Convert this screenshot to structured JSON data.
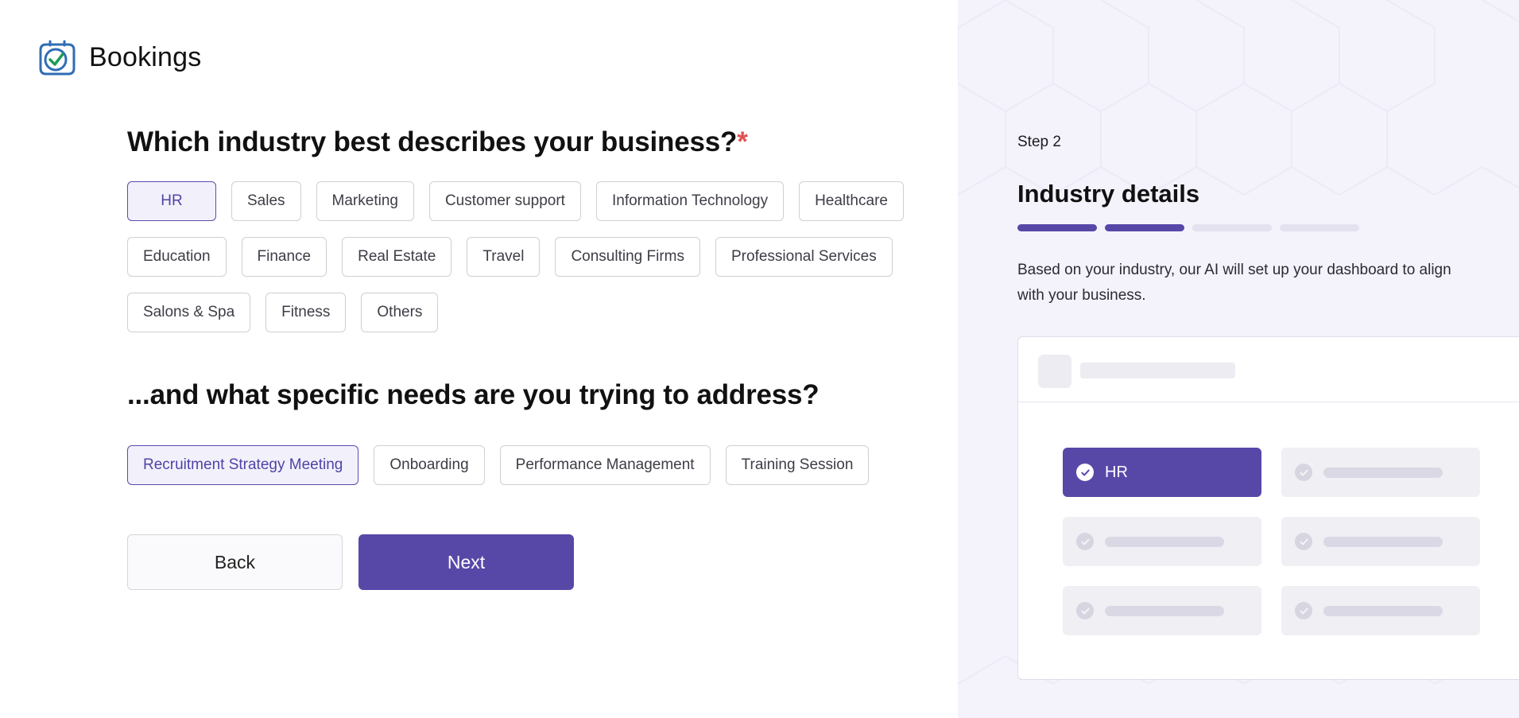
{
  "brand": {
    "name": "Bookings",
    "icon": "calendar-check-icon"
  },
  "industry_question": {
    "text": "Which industry best describes your business?",
    "required_mark": "*"
  },
  "industries": [
    {
      "label": "HR",
      "selected": true
    },
    {
      "label": "Sales",
      "selected": false
    },
    {
      "label": "Marketing",
      "selected": false
    },
    {
      "label": "Customer support",
      "selected": false
    },
    {
      "label": "Information Technology",
      "selected": false
    },
    {
      "label": "Healthcare",
      "selected": false
    },
    {
      "label": "Education",
      "selected": false
    },
    {
      "label": "Finance",
      "selected": false
    },
    {
      "label": "Real Estate",
      "selected": false
    },
    {
      "label": "Travel",
      "selected": false
    },
    {
      "label": "Consulting Firms",
      "selected": false
    },
    {
      "label": "Professional Services",
      "selected": false
    },
    {
      "label": "Salons & Spa",
      "selected": false
    },
    {
      "label": "Fitness",
      "selected": false
    },
    {
      "label": "Others",
      "selected": false
    }
  ],
  "needs_question": {
    "text": "...and what specific needs are you trying to address?"
  },
  "needs": [
    {
      "label": "Recruitment Strategy Meeting",
      "selected": true
    },
    {
      "label": "Onboarding",
      "selected": false
    },
    {
      "label": "Performance Management",
      "selected": false
    },
    {
      "label": "Training Session",
      "selected": false
    }
  ],
  "actions": {
    "back_label": "Back",
    "next_label": "Next"
  },
  "side_panel": {
    "step_label": "Step 2",
    "title": "Industry details",
    "progress": {
      "total_steps": 4,
      "completed_steps": 2
    },
    "description": "Based on your industry, our AI will set up your dashboard to align with your business.",
    "preview": {
      "active_card_label": "HR",
      "card_count": 6
    }
  },
  "colors": {
    "accent": "#5748a8",
    "required": "#e05151",
    "panel_bg": "#f4f3fc",
    "selected_chip_bg": "#f2f1fb"
  }
}
